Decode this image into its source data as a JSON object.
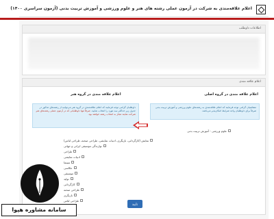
{
  "header": {
    "title": "اعلام علاقه‌مندی به شرکت در آزمون عملی رشته های هنر و علوم ورزشی و آموزش تربیت بدنی (آزمون سراسری ۱۴۰۰)"
  },
  "panel_info": {
    "heading": "اطلاعات داوطلب"
  },
  "panel_form": {
    "heading": "اعلام علاقه مندی"
  },
  "right_column": {
    "title": "اعلام علاقه مندی در گروه اصلی",
    "info_text": "متقاضیان گرامی توجه فرمایند که اعلام علاقه‌مندی به رشته‌های علوم ورزشی و آموزش تربیت بدنی صرفاً برای داوطلبان واجد شرایط امکان‌پذیر می‌باشد.",
    "option_label": "علوم ورزشی - آموزش تربیت بدنی"
  },
  "left_column": {
    "title": "اعلام علاقه مندی در گروه هنر",
    "info_text": "داوطلبان گرامی توجه فرمایند که اعلام علاقه‌مندی در گروه هنر می‌توانید از رشته‌های مذکور در جدول زیر حداکثر سه مورد را انتخاب نمایید.",
    "info_text_red": "صرفاً تنها داوطلبانی که در آزمون عملی رشته‌های هنر شرکت نمایند مجاز به انتخاب رشته خواهند بود.",
    "options": [
      "نمایش (کارگردانی، بازیگری، ادبیات نمایشی، طراحی صحنه، طراحی لباس)",
      "نوازندگی موسیقی ایرانی و جهانی",
      "طراحی",
      "ادبیات نمایشی",
      "سینما",
      "عکاسی",
      "موسیقی",
      "تولید",
      "کارگردانی",
      "طراحی صحنه",
      "بازیگری",
      "طراحی لباس",
      "نقاشی"
    ]
  },
  "submit_label": "تایید",
  "watermark": {
    "text": "سامانه مشاوره هپوا"
  },
  "colors": {
    "accent_red": "#b81c1c",
    "info_blue": "#dff0fa",
    "button_blue": "#2f6db5"
  }
}
